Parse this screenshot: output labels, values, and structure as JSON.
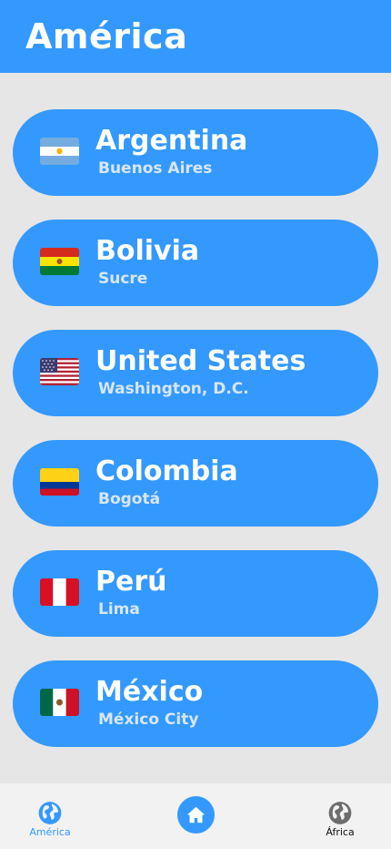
{
  "header": {
    "title": "América"
  },
  "countries": [
    {
      "name": "Argentina",
      "capital": "Buenos Aires",
      "flag": "argentina-flag-icon"
    },
    {
      "name": "Bolivia",
      "capital": "Sucre",
      "flag": "bolivia-flag-icon"
    },
    {
      "name": "United States",
      "capital": "Washington, D.C.",
      "flag": "usa-flag-icon"
    },
    {
      "name": "Colombia",
      "capital": "Bogotá",
      "flag": "colombia-flag-icon"
    },
    {
      "name": "Perú",
      "capital": "Lima",
      "flag": "peru-flag-icon"
    },
    {
      "name": "México",
      "capital": "México City",
      "flag": "mexico-flag-icon"
    }
  ],
  "bottom_nav": {
    "items": [
      {
        "label": "América",
        "icon": "globe-icon",
        "active": true
      },
      {
        "label": "",
        "icon": "home-icon",
        "active": false
      },
      {
        "label": "África",
        "icon": "globe-icon",
        "active": false
      }
    ]
  },
  "colors": {
    "accent": "#3399ff",
    "background": "#e6e6e6",
    "card_text": "#ffffff",
    "capital_text": "#d8e6f2",
    "nav_background": "#f2f2f2",
    "nav_inactive": "#6d6d6d"
  }
}
